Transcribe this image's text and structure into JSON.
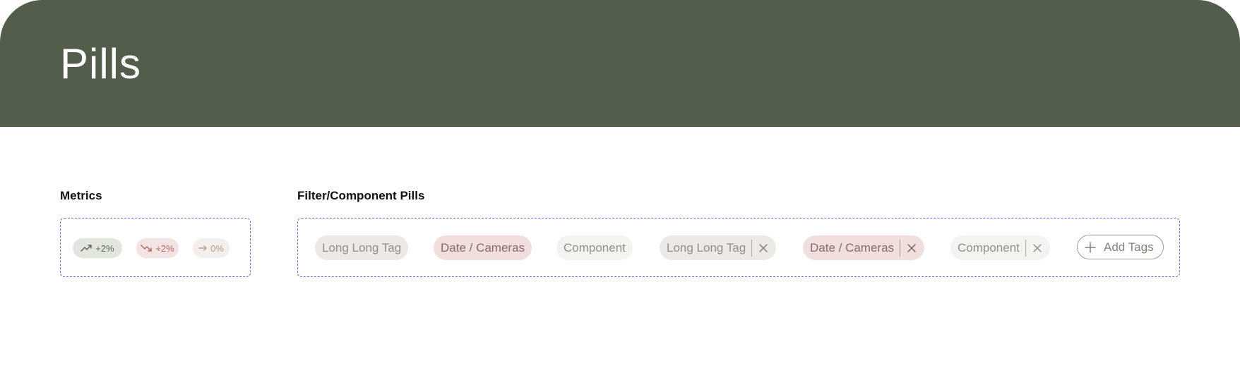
{
  "header": {
    "title": "Pills"
  },
  "metrics": {
    "label": "Metrics",
    "pills": [
      {
        "value": "+2%",
        "icon": "trend-up-icon",
        "color": "#5c6955"
      },
      {
        "value": "+2%",
        "icon": "trend-down-icon",
        "color": "#b46a6a"
      },
      {
        "value": "0%",
        "icon": "arrow-right-icon",
        "color": "#c09a8a"
      }
    ]
  },
  "filters": {
    "label": "Filter/Component Pills",
    "pills": [
      {
        "label": "Long Long Tag",
        "style": "grey"
      },
      {
        "label": "Date / Cameras",
        "style": "pink"
      },
      {
        "label": "Component",
        "style": "light"
      },
      {
        "label": "Long Long Tag",
        "style": "grey",
        "closable": true
      },
      {
        "label": "Date / Cameras",
        "style": "pink",
        "closable": true
      },
      {
        "label": "Component",
        "style": "light",
        "closable": true
      }
    ],
    "add_label": "Add Tags"
  },
  "colors": {
    "header_bg": "#525e4b",
    "dashed_border": "#9b5cf0"
  }
}
